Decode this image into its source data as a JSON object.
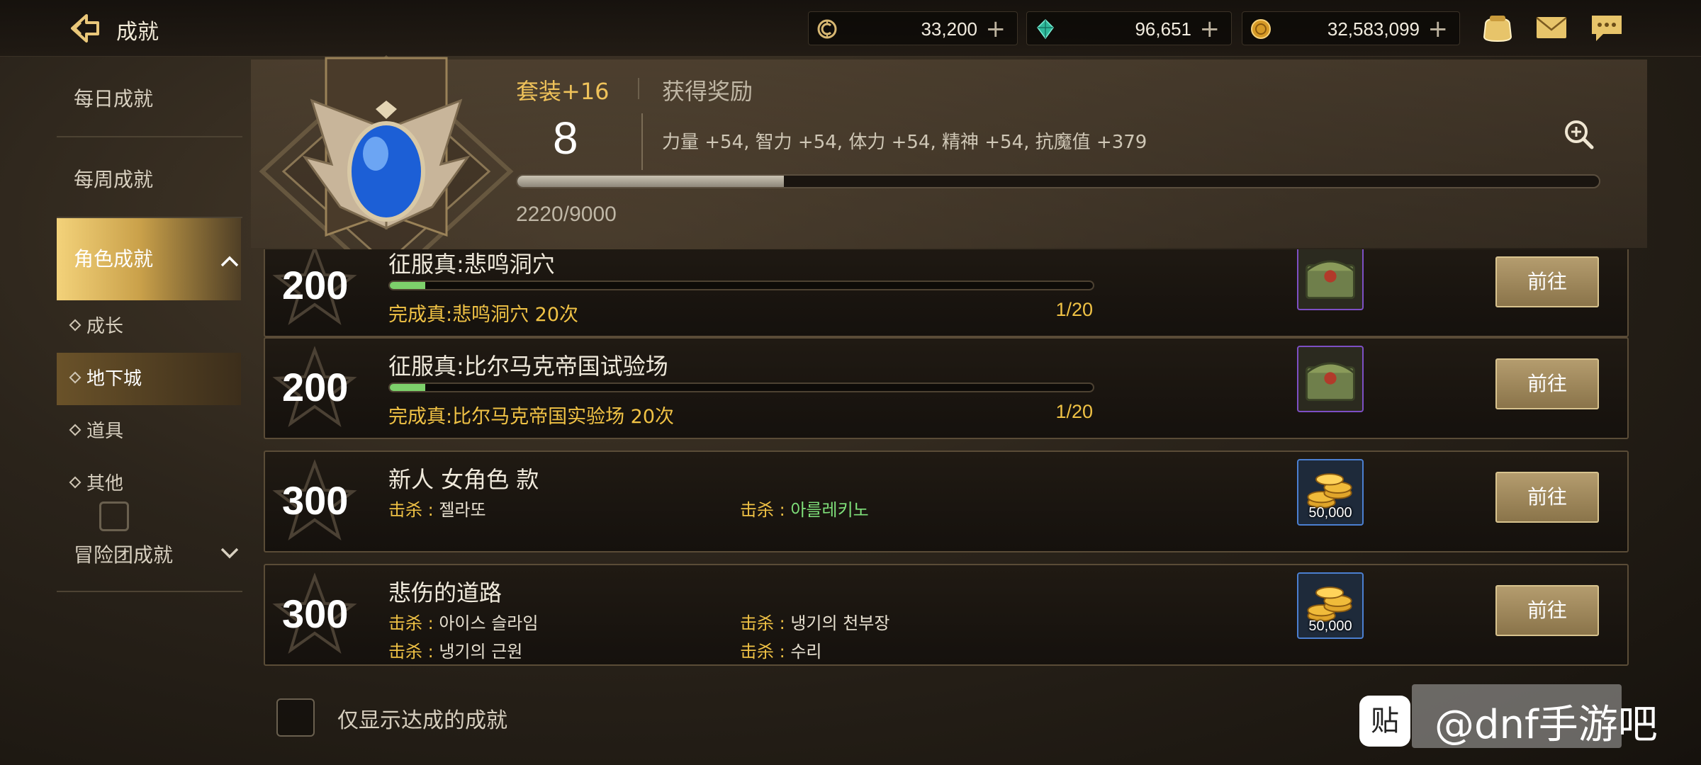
{
  "header": {
    "title": "成就",
    "currencies": [
      {
        "name": "coin-c-icon",
        "value": "33,200"
      },
      {
        "name": "gem-icon",
        "value": "96,651"
      },
      {
        "name": "gold-coin-icon",
        "value": "32,583,099"
      }
    ],
    "plus_label": "+",
    "icons": [
      "coin-purse-icon",
      "mail-icon",
      "chat-icon"
    ]
  },
  "sidebar": {
    "items": [
      {
        "label": "每日成就"
      },
      {
        "label": "每周成就"
      },
      {
        "label": "角色成就"
      },
      {
        "label": "冒险团成就"
      }
    ],
    "sub_items": [
      {
        "label": "成长"
      },
      {
        "label": "地下城"
      },
      {
        "label": "道具"
      },
      {
        "label": "其他"
      }
    ]
  },
  "level": {
    "tab_left": "套装+16",
    "tab_right": "获得奖励",
    "level": "8",
    "bonus": "力量 +54, 智力 +54, 体力 +54, 精神 +54, 抗魔值 +379",
    "progress_text": "2220/9000",
    "progress_fraction": 0.2467
  },
  "achievements": [
    {
      "points": "200",
      "name": "征服真:悲鸣洞穴",
      "progress_fraction": 0.05,
      "condition": "完成真:悲鸣洞穴 20次",
      "count": "1/20",
      "reward": "chest",
      "button": "前往"
    },
    {
      "points": "200",
      "name": "征服真:比尔马克帝国试验场",
      "progress_fraction": 0.05,
      "condition": "完成真:比尔马克帝国实验场 20次",
      "count": "1/20",
      "reward": "chest",
      "button": "前往"
    },
    {
      "points": "300",
      "name": "新人 女角色 款",
      "kills": [
        {
          "label": "击杀 : ",
          "value": "젤라또",
          "color": "#e7e0d0"
        },
        {
          "label": "击杀 : ",
          "value": "아를레키노",
          "color": "#7fe07a"
        }
      ],
      "reward": "gold",
      "reward_qty": "50,000",
      "button": "前往"
    },
    {
      "points": "300",
      "name": "悲伤的道路",
      "kills": [
        {
          "label": "击杀 : ",
          "value": "아이스 슬라임",
          "color": "#e7e0d0"
        },
        {
          "label": "击杀 : ",
          "value": "냉기의 천부장",
          "color": "#e7e0d0"
        },
        {
          "label": "击杀 : ",
          "value": "냉기의 근원",
          "color": "#e7e0d0"
        },
        {
          "label": "击杀 : ",
          "value": "수리",
          "color": "#e7e0d0"
        }
      ],
      "reward": "gold",
      "reward_qty": "50,000",
      "button": "前往"
    }
  ],
  "footer": {
    "checkbox_label": "仅显示达成的成就"
  },
  "watermark": {
    "logo": "贴",
    "text": "@dnf手游吧"
  },
  "colors": {
    "accent_gold": "#f0c245",
    "progress_green": "#7dd16b",
    "active_tab": "#f3d27a"
  }
}
